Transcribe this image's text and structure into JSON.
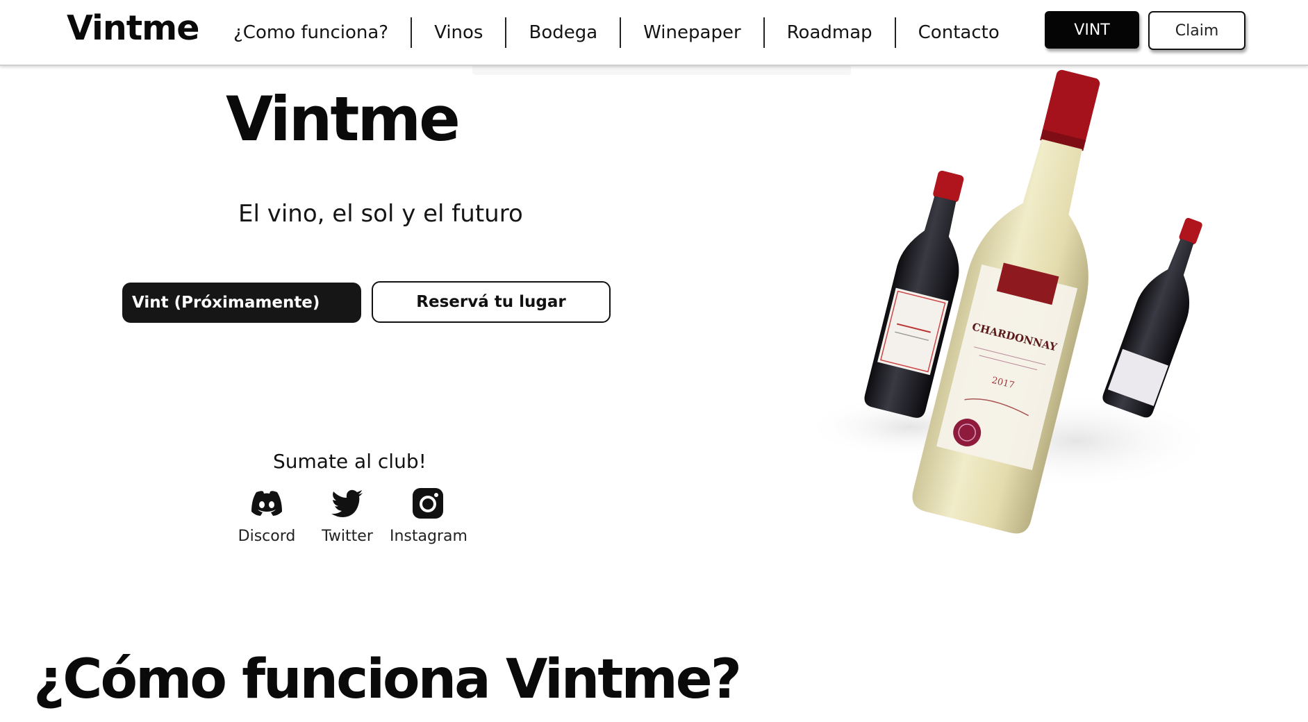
{
  "header": {
    "brand": "Vintme",
    "nav": [
      "¿Como funciona?",
      "Vinos",
      "Bodega",
      "Winepaper",
      "Roadmap",
      "Contacto"
    ],
    "vint_button": "VINT",
    "claim_button": "Claim"
  },
  "hero": {
    "title": "Vintme",
    "subtitle": "El vino, el sol y el futuro",
    "cta_primary": "Vint (Próximamente)",
    "cta_secondary": "Reservá tu lugar",
    "club_title": "Sumate al club!",
    "socials": [
      {
        "label": "Discord",
        "icon": "discord-icon"
      },
      {
        "label": "Twitter",
        "icon": "twitter-icon"
      },
      {
        "label": "Instagram",
        "icon": "instagram-icon"
      }
    ],
    "bottle_labels": {
      "main": "CHARDONNAY",
      "vintage": "2017"
    }
  },
  "section": {
    "title": "¿Cómo funciona Vintme?"
  },
  "colors": {
    "accent_dark": "#161616",
    "capsule_red": "#b0141c",
    "white_wine": "#e8e2b8"
  }
}
